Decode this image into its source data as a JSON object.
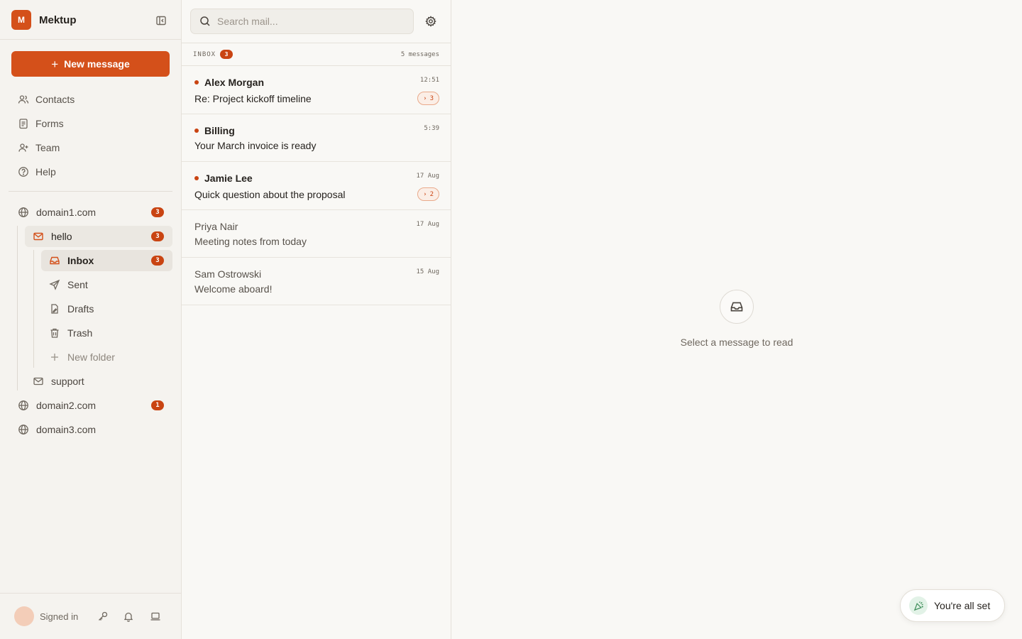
{
  "app": {
    "logo_letter": "M",
    "name": "Mektup",
    "accent": "#d4501a"
  },
  "sidebar": {
    "new_message_label": "New message",
    "nav": [
      {
        "label": "Contacts",
        "icon": "contacts-icon"
      },
      {
        "label": "Forms",
        "icon": "forms-icon"
      },
      {
        "label": "Team",
        "icon": "team-icon"
      },
      {
        "label": "Help",
        "icon": "help-icon"
      }
    ],
    "tree": {
      "domain1": {
        "label": "domain1.com",
        "count": "3"
      },
      "hello": {
        "label": "hello",
        "count": "3"
      },
      "inbox": {
        "label": "Inbox",
        "count": "3"
      },
      "sent": {
        "label": "Sent"
      },
      "drafts": {
        "label": "Drafts"
      },
      "trash": {
        "label": "Trash"
      },
      "new_folder": {
        "label": "New folder"
      },
      "support": {
        "label": "support"
      },
      "domain2": {
        "label": "domain2.com",
        "count": "1"
      },
      "domain3": {
        "label": "domain3.com"
      }
    },
    "account": {
      "status": "Signed in"
    }
  },
  "list": {
    "search_placeholder": "Search mail...",
    "folder_title": "INBOX",
    "unread_count": "3",
    "total_label": "5 messages",
    "messages": [
      {
        "sender": "Alex Morgan",
        "subject": "Re: Project kickoff timeline",
        "time": "12:51",
        "thread": "3",
        "unread": true
      },
      {
        "sender": "Billing",
        "subject": "Your March invoice is ready",
        "time": "5:39",
        "unread": true
      },
      {
        "sender": "Jamie Lee",
        "subject": "Quick question about the proposal",
        "time": "17 Aug",
        "thread": "2",
        "unread": true
      },
      {
        "sender": "Priya Nair",
        "subject": "Meeting notes from today",
        "time": "17 Aug",
        "unread": false
      },
      {
        "sender": "Sam Ostrowski",
        "subject": "Welcome aboard!",
        "time": "15 Aug",
        "unread": false
      }
    ]
  },
  "reader": {
    "empty_text": "Select a message to read"
  },
  "toast": {
    "label": "You're all set"
  }
}
